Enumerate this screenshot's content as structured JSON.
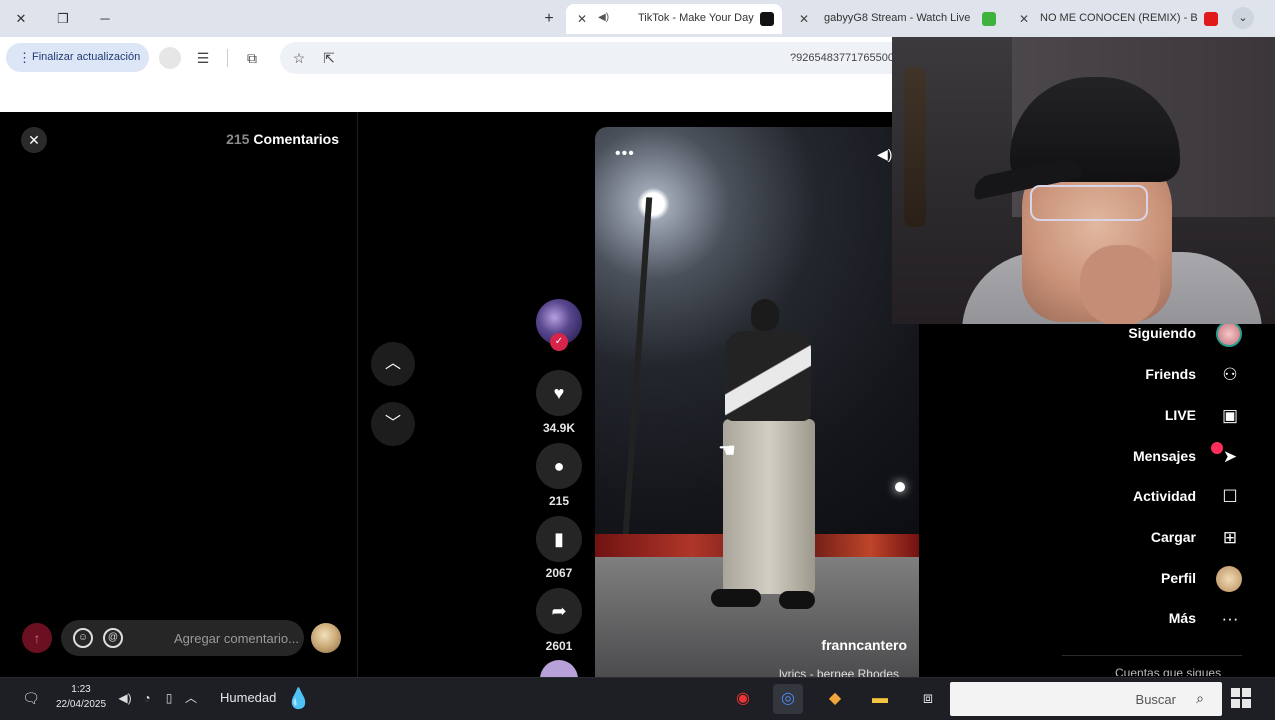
{
  "browser": {
    "tabs": [
      {
        "title": "NO ME CONOCEN (REMIX) - B",
        "favicon_color": "#e01a1a",
        "active": false
      },
      {
        "title": "gabyyG8 Stream - Watch Live",
        "favicon_color": "#3db23d",
        "active": false
      },
      {
        "title": "TikTok - Make Your Day",
        "favicon_color": "#111111",
        "active": true
      }
    ],
    "new_tab": "+",
    "tab_menu": "⌄",
    "update_button": "Finalizar actualización",
    "url": "?9265483771765500"
  },
  "comments": {
    "title": "Comentarios",
    "count": "215",
    "input_placeholder": "Agregar comentario..."
  },
  "actions": {
    "likes": "34.9K",
    "comments": "215",
    "saves": "2067",
    "shares": "2601"
  },
  "video": {
    "author": "franncantero",
    "music": "lyrics - bernee Rhodes"
  },
  "sidebar": {
    "items": [
      {
        "label": "Siguiendo",
        "icon": "following-avatar-icon"
      },
      {
        "label": "Friends",
        "icon": "friends-icon"
      },
      {
        "label": "LIVE",
        "icon": "live-icon"
      },
      {
        "label": "Mensajes",
        "icon": "messages-icon"
      },
      {
        "label": "Actividad",
        "icon": "activity-icon"
      },
      {
        "label": "Cargar",
        "icon": "upload-icon"
      },
      {
        "label": "Perfil",
        "icon": "profile-avatar-icon"
      },
      {
        "label": "Más",
        "icon": "more-icon"
      }
    ],
    "footer": "Cuentas que sigues"
  },
  "taskbar": {
    "time": "1:23",
    "date": "22/04/2025",
    "weather": "Humedad",
    "search": "Buscar"
  },
  "colors": {
    "tiktok_red": "#fe2c55",
    "send_button": "#6b1020",
    "taskbar": "#1d1f24"
  }
}
